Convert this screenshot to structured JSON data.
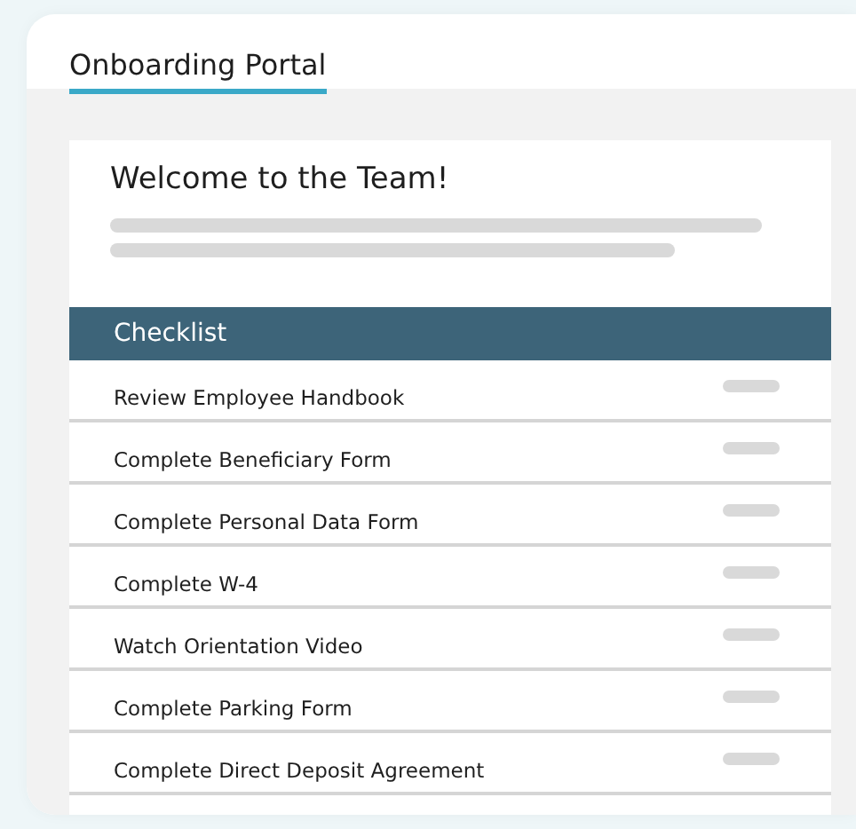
{
  "tabs": [
    {
      "label": "Onboarding Portal",
      "selected": true
    }
  ],
  "welcome": {
    "heading": "Welcome to the Team!"
  },
  "checklist": {
    "title": "Checklist",
    "items": [
      {
        "label": "Review Employee Handbook"
      },
      {
        "label": "Complete Beneficiary Form"
      },
      {
        "label": "Complete Personal Data Form"
      },
      {
        "label": "Complete W-4"
      },
      {
        "label": "Watch Orientation Video"
      },
      {
        "label": "Complete Parking Form"
      },
      {
        "label": "Complete Direct Deposit Agreement"
      }
    ]
  }
}
